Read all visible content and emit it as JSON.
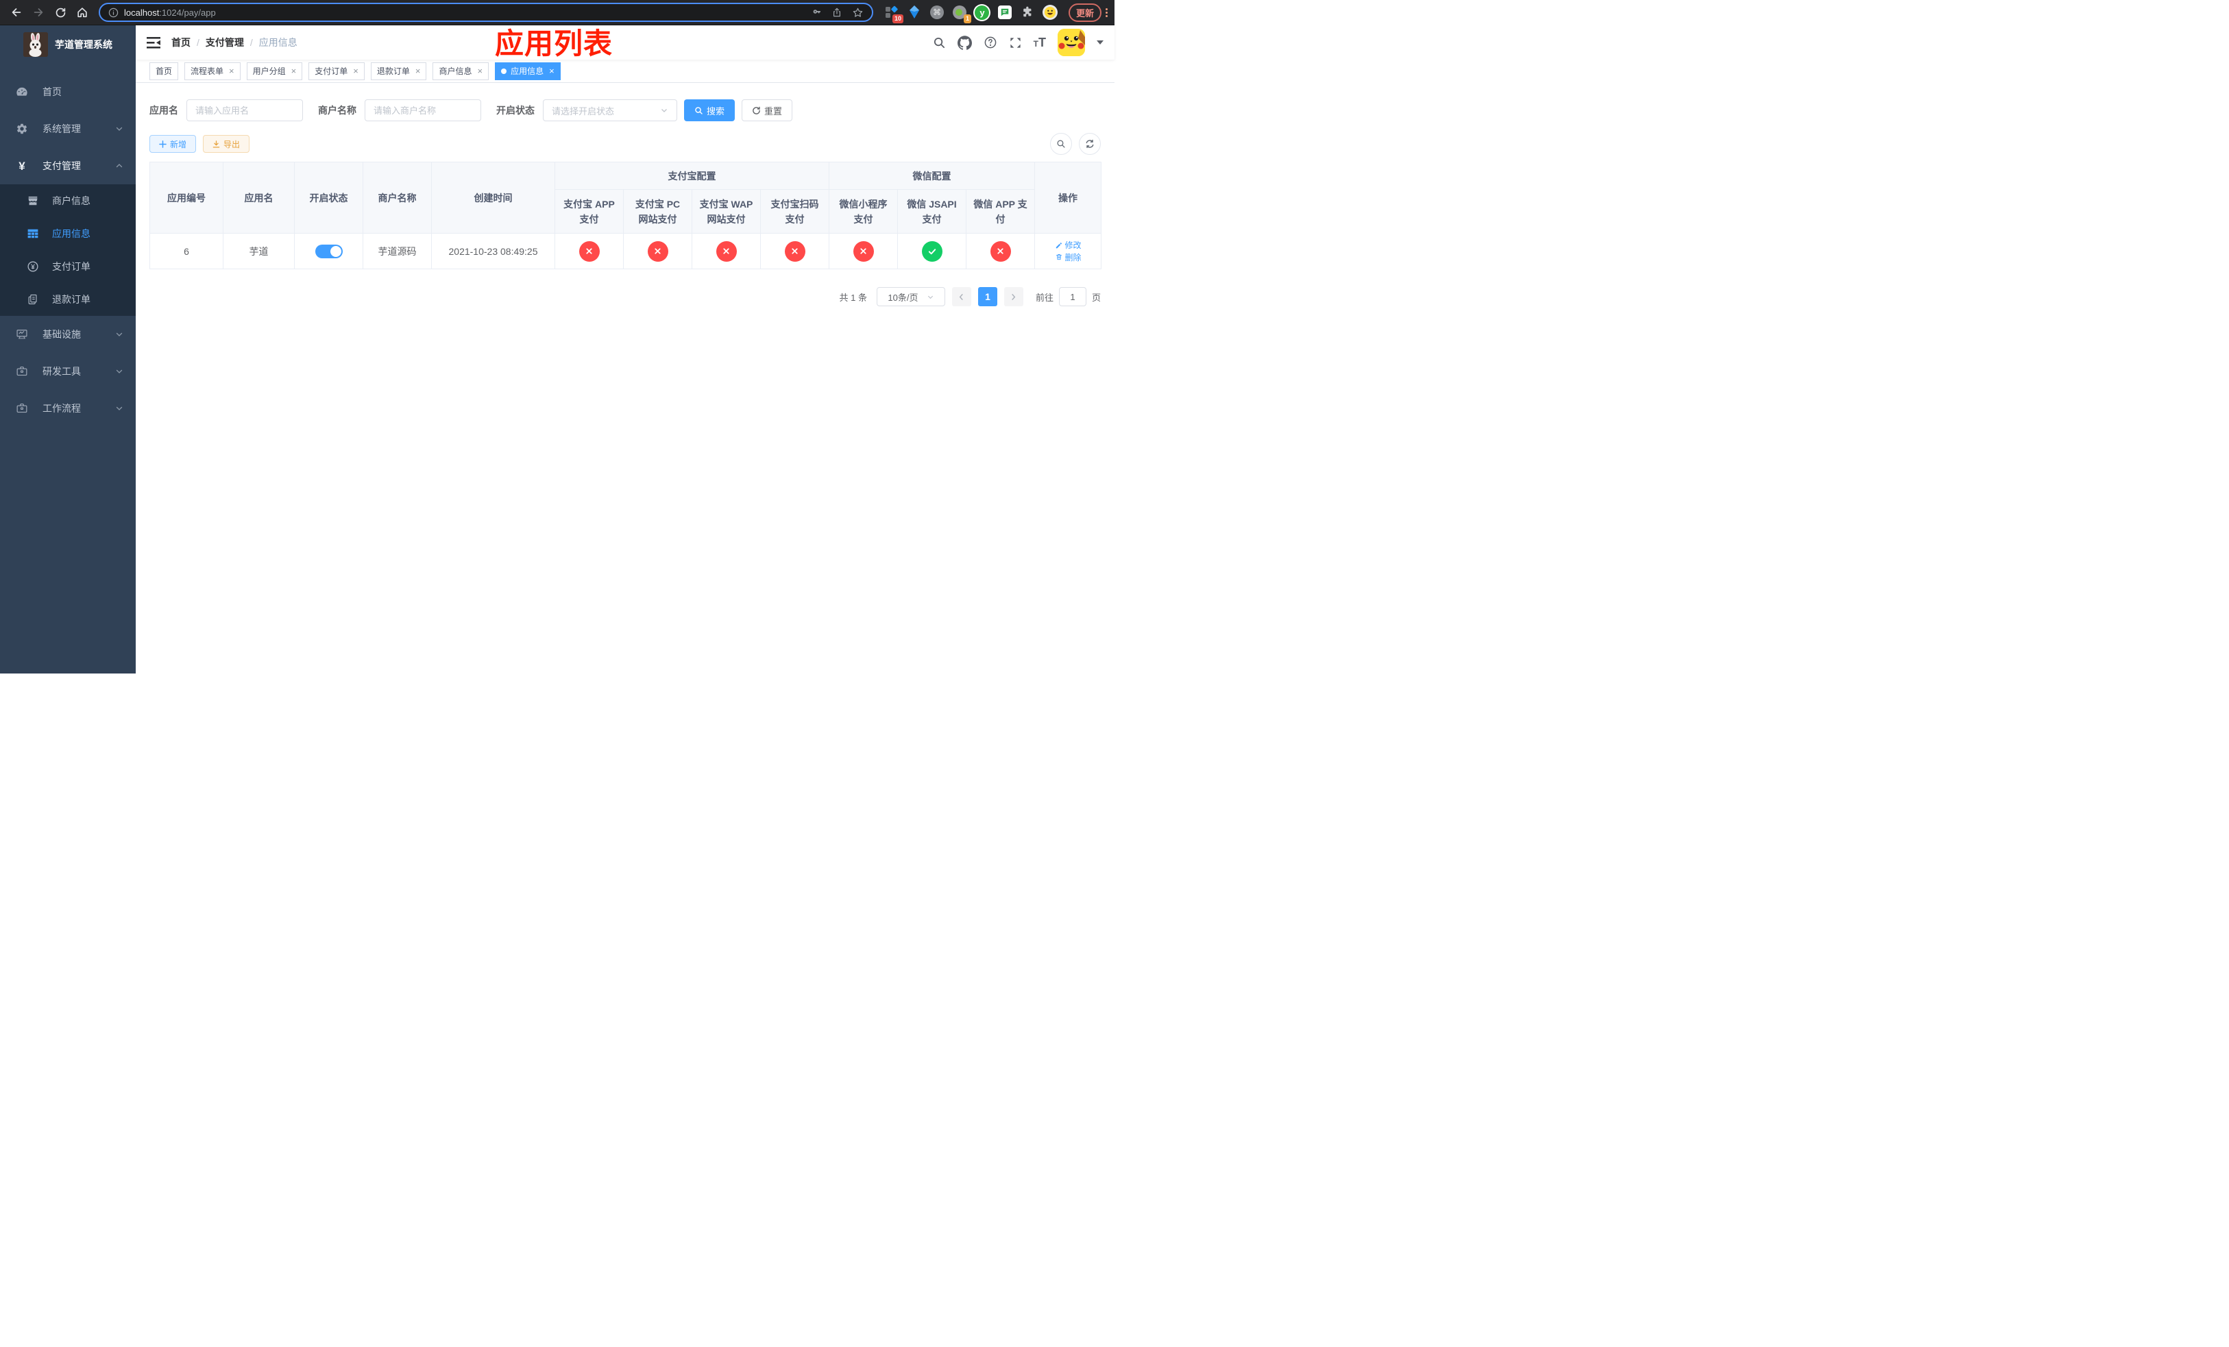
{
  "browser": {
    "url_host": "localhost",
    "url_rest": ":1024/pay/app",
    "update_label": "更新",
    "ext_badge_blue_diamond": "10",
    "ext_badge_recorder": "1",
    "y_ext_letter": "y",
    "cmd_glyph": "⌘"
  },
  "sidebar": {
    "title": "芋道管理系统",
    "items": [
      {
        "key": "home",
        "label": "首页",
        "icon": "dashboard-icon",
        "type": "item"
      },
      {
        "key": "system",
        "label": "系统管理",
        "icon": "gear-icon",
        "type": "parent",
        "arrow": "down"
      },
      {
        "key": "payment",
        "label": "支付管理",
        "icon": "yen-icon",
        "type": "parent-open",
        "arrow": "up"
      },
      {
        "key": "merchant-info",
        "label": "商户信息",
        "icon": "shop-icon",
        "type": "sub"
      },
      {
        "key": "app-info",
        "label": "应用信息",
        "icon": "grid-icon",
        "type": "sub",
        "active": true
      },
      {
        "key": "pay-order",
        "label": "支付订单",
        "icon": "yen-circle-icon",
        "type": "sub"
      },
      {
        "key": "refund-order",
        "label": "退款订单",
        "icon": "document-icon",
        "type": "sub"
      },
      {
        "key": "infrastructure",
        "label": "基础设施",
        "icon": "monitor-icon",
        "type": "parent",
        "arrow": "down"
      },
      {
        "key": "dev-tools",
        "label": "研发工具",
        "icon": "briefcase-icon",
        "type": "parent",
        "arrow": "down"
      },
      {
        "key": "workflow",
        "label": "工作流程",
        "icon": "briefcase-icon",
        "type": "parent",
        "arrow": "down"
      }
    ]
  },
  "navbar": {
    "breadcrumb": [
      "首页",
      "支付管理",
      "应用信息"
    ],
    "annotation": "应用列表"
  },
  "tabs": [
    {
      "key": "home",
      "label": "首页",
      "closable": false,
      "active": false
    },
    {
      "key": "flow-form",
      "label": "流程表单",
      "closable": true,
      "active": false
    },
    {
      "key": "user-group",
      "label": "用户分组",
      "closable": true,
      "active": false
    },
    {
      "key": "pay-order",
      "label": "支付订单",
      "closable": true,
      "active": false
    },
    {
      "key": "refund-order",
      "label": "退款订单",
      "closable": true,
      "active": false
    },
    {
      "key": "merchant-info",
      "label": "商户信息",
      "closable": true,
      "active": false
    },
    {
      "key": "app-info",
      "label": "应用信息",
      "closable": true,
      "active": true
    }
  ],
  "filters": {
    "app_name_label": "应用名",
    "app_name_placeholder": "请输入应用名",
    "merchant_label": "商户名称",
    "merchant_placeholder": "请输入商户名称",
    "status_label": "开启状态",
    "status_placeholder": "请选择开启状态",
    "search_label": "搜索",
    "reset_label": "重置"
  },
  "toolbar": {
    "add_label": "新增",
    "export_label": "导出"
  },
  "table": {
    "simple_headers": [
      "应用编号",
      "应用名",
      "开启状态",
      "商户名称",
      "创建时间"
    ],
    "groups": [
      {
        "label": "支付宝配置",
        "children": [
          "支付宝 APP 支付",
          "支付宝 PC 网站支付",
          "支付宝 WAP 网站支付",
          "支付宝扫码支付"
        ]
      },
      {
        "label": "微信配置",
        "children": [
          "微信小程序支付",
          "微信 JSAPI 支付",
          "微信 APP 支付"
        ]
      }
    ],
    "action_header": "操作",
    "rows": [
      {
        "id": "6",
        "name": "芋道",
        "enabled": true,
        "merchant": "芋道源码",
        "created": "2021-10-23 08:49:25",
        "statuses": [
          "no",
          "no",
          "no",
          "no",
          "no",
          "yes",
          "no"
        ],
        "edit_label": "修改",
        "delete_label": "删除"
      }
    ]
  },
  "pagination": {
    "total": "共 1 条",
    "page_size": "10条/页",
    "current_page": "1",
    "goto_label": "前往",
    "goto_value": "1",
    "page_unit": "页"
  },
  "colors": {
    "primary": "#409eff",
    "danger": "#ff4949",
    "success": "#13ce66",
    "annotation_red": "#ff1f05",
    "sidebar_bg": "#304156",
    "submenu_bg": "#1f2d3d"
  }
}
